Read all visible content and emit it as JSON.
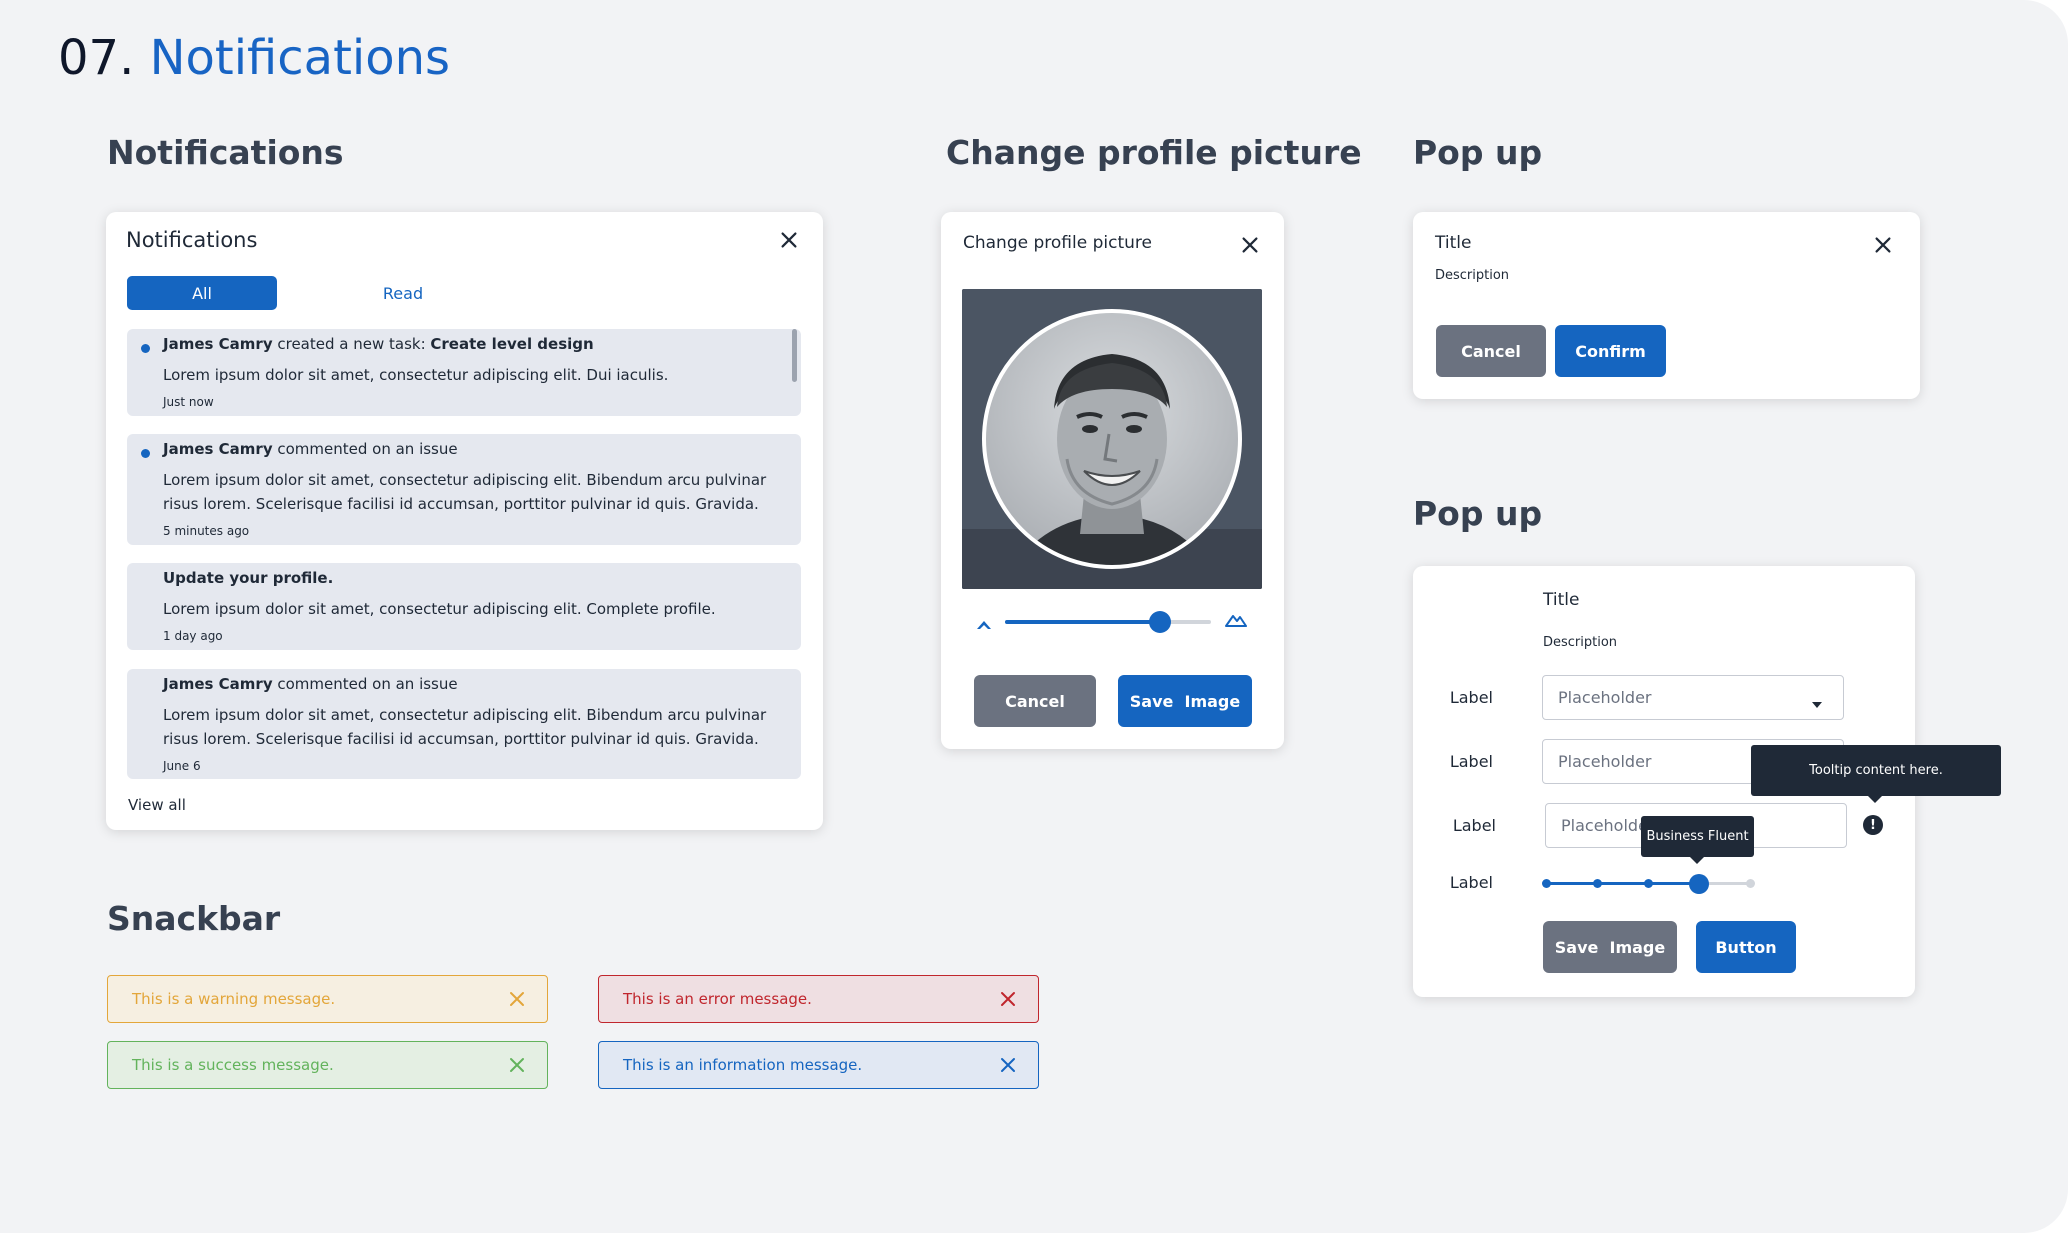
{
  "page": {
    "number": "07.",
    "title": "Notifications"
  },
  "sections": {
    "notifications": "Notifications",
    "change_picture": "Change profile picture",
    "popup1": "Pop up",
    "popup2": "Pop up",
    "snackbar": "Snackbar"
  },
  "notifications_panel": {
    "title": "Notifications",
    "tabs": [
      {
        "label": "All",
        "active": true
      },
      {
        "label": "Read",
        "active": false
      }
    ],
    "items": [
      {
        "unread": true,
        "name": "James Camry",
        "action": " created a new task: ",
        "target": "Create level design",
        "body": "Lorem ipsum dolor sit amet, consectetur adipiscing elit. Dui iaculis.",
        "time": "Just now"
      },
      {
        "unread": true,
        "name": "James Camry",
        "action": " commented on an issue",
        "target": "",
        "body": "Lorem ipsum dolor sit amet, consectetur adipiscing elit. Bibendum arcu pulvinar risus lorem. Scelerisque facilisi id accumsan, porttitor pulvinar id quis. Gravida.",
        "time": "5 minutes ago"
      },
      {
        "unread": false,
        "name": "Update your profile.",
        "action": "",
        "target": "",
        "body": "Lorem ipsum dolor sit amet, consectetur adipiscing elit. Complete profile.",
        "time": "1 day ago"
      },
      {
        "unread": false,
        "name": "James Camry",
        "action": " commented on an issue",
        "target": "",
        "body": "Lorem ipsum dolor sit amet, consectetur adipiscing elit. Bibendum arcu pulvinar risus lorem. Scelerisque facilisi id accumsan, porttitor pulvinar id quis. Gravida.",
        "time": "June 6"
      }
    ],
    "view_all": "View all"
  },
  "profile_dialog": {
    "title": "Change profile picture",
    "zoom_value": 0.75,
    "cancel": "Cancel",
    "save": "Save  Image"
  },
  "popup_simple": {
    "title": "Title",
    "description": "Description",
    "cancel": "Cancel",
    "confirm": "Confirm"
  },
  "popup_form": {
    "title": "Title",
    "description": "Description",
    "fields": [
      {
        "label": "Label",
        "placeholder": "Placeholder",
        "type": "select"
      },
      {
        "label": "Label",
        "placeholder": "Placeholder",
        "type": "text"
      },
      {
        "label": "Label",
        "placeholder": "Placeholder",
        "type": "text"
      }
    ],
    "slider": {
      "label": "Label",
      "steps": 5,
      "value_index": 3,
      "tooltip": "Business Fluent"
    },
    "info_tooltip": "Tooltip content here.",
    "save": "Save  Image",
    "button": "Button"
  },
  "snackbars": [
    {
      "kind": "warning",
      "text": "This is a warning message.",
      "color": "#e3a63a",
      "bg": "#f6efe1"
    },
    {
      "kind": "error",
      "text": "This is an error message.",
      "color": "#c0262d",
      "bg": "#efdfe2"
    },
    {
      "kind": "success",
      "text": "This is a success message.",
      "color": "#63b35c",
      "bg": "#e4efe3"
    },
    {
      "kind": "info",
      "text": "This is an information message.",
      "color": "#1565c0",
      "bg": "#e1e8f3"
    }
  ],
  "colors": {
    "accent": "#1565c0",
    "heading": "#374151",
    "page_bg": "#f2f3f5"
  }
}
